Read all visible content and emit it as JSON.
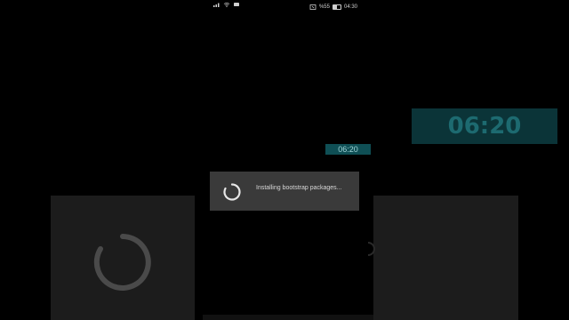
{
  "status_bar": {
    "battery_text": "%55",
    "clock": "04:30",
    "left_icons": [
      "signal-icon",
      "wifi-icon",
      "notification-icon"
    ],
    "right_icons": [
      "nfc-icon",
      "battery-icon"
    ]
  },
  "overlay": {
    "time_large": "06:20",
    "time_small": "06:20",
    "accent_color": "#0f4f55"
  },
  "dialog": {
    "message": "Installing bootstrap packages...",
    "spinner": "progress-spinner-icon"
  }
}
